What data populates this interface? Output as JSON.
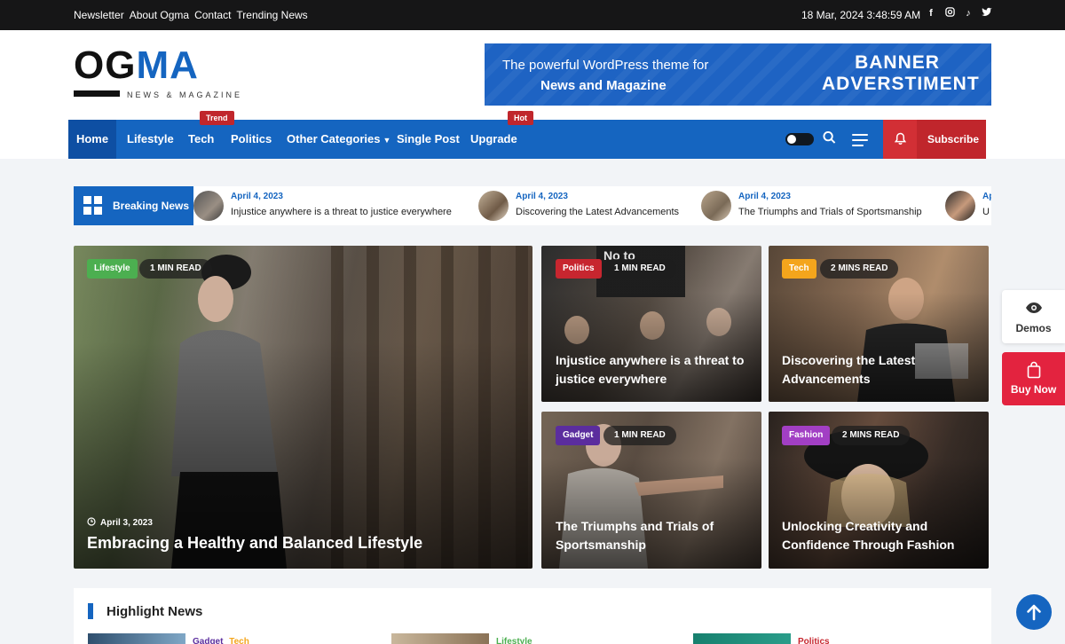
{
  "topbar": {
    "links": [
      "Newsletter",
      "About Ogma",
      "Contact",
      "Trending News"
    ],
    "datetime": "18 Mar, 2024 3:48:59 AM",
    "social": [
      "facebook-icon",
      "instagram-icon",
      "tiktok-icon",
      "twitter-icon"
    ]
  },
  "logo": {
    "o": "O",
    "g": "G",
    "ma": "MA",
    "sub": "NEWS & MAGAZINE"
  },
  "banner": {
    "line1": "The powerful WordPress theme for",
    "line2": "News and Magazine",
    "big1": "BANNER",
    "big2": "ADVERSTIMENT",
    "color": "#1e63c3"
  },
  "nav": {
    "home": "Home",
    "lifestyle": "Lifestyle",
    "tech": "Tech",
    "politics": "Politics",
    "other": "Other Categories",
    "single": "Single Post",
    "upgrade": "Upgrade",
    "tag_trend": "Trend",
    "tag_hot": "Hot",
    "subscribe": "Subscribe",
    "color": "#1565c0"
  },
  "breaking": {
    "label": "Breaking News",
    "items": [
      {
        "date": "April 4, 2023",
        "title": "Injustice anywhere is a threat to justice everywhere"
      },
      {
        "date": "April 4, 2023",
        "title": "Discovering the Latest Advancements"
      },
      {
        "date": "April 4, 2023",
        "title": "The Triumphs and Trials of Sportsmanship"
      },
      {
        "date": "Ap",
        "title": "U"
      }
    ]
  },
  "cards": {
    "main": {
      "category": "Lifestyle",
      "read": "1 MIN READ",
      "date": "April 3, 2023",
      "title": "Embracing a Healthy and Balanced Lifestyle"
    },
    "c1": {
      "category": "Politics",
      "read": "1 MIN READ",
      "title": "Injustice anywhere is a threat to justice everywhere"
    },
    "c2": {
      "category": "Tech",
      "read": "2 MINS READ",
      "title": "Discovering the Latest Advancements"
    },
    "c3": {
      "category": "Gadget",
      "read": "1 MIN READ",
      "title": "The Triumphs and Trials of Sportsmanship"
    },
    "c4": {
      "category": "Fashion",
      "read": "2 MINS READ",
      "title": "Unlocking Creativity and Confidence Through Fashion"
    }
  },
  "side": {
    "demos": "Demos",
    "buy": "Buy Now"
  },
  "highlight": {
    "title": "Highlight News",
    "items": [
      {
        "cat1": "Gadget",
        "cat2": "Tech"
      },
      {
        "cat1": "Lifestyle"
      },
      {
        "cat1": "Politics"
      }
    ]
  }
}
